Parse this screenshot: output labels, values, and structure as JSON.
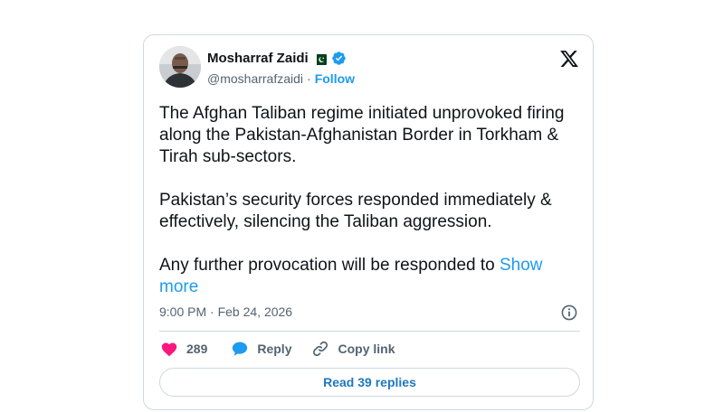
{
  "author": {
    "name": "Mosharraf Zaidi",
    "handle": "@mosharrafzaidi",
    "separator": "·",
    "follow_label": "Follow"
  },
  "tweet": {
    "paragraph1": "The Afghan Taliban regime initiated unprovoked firing along the Pakistan-Afghanistan Border in Torkham & Tirah sub-sectors.",
    "paragraph2": "Pakistan’s security forces responded immediately & effectively, silencing the Taliban aggression.",
    "paragraph3": "Any further provocation will be responded to ",
    "show_more": "Show more",
    "timestamp": "9:00 PM · Feb 24, 2026"
  },
  "actions": {
    "like_count": "289",
    "reply_label": "Reply",
    "copy_link_label": "Copy link"
  },
  "read_replies_label": "Read 39 replies",
  "colors": {
    "accent": "#1d9bf0",
    "like": "#f91880",
    "text_secondary": "#536471",
    "border": "#cfd9de"
  },
  "icons": [
    "avatar",
    "pakistan-flag-icon",
    "verified-badge-icon",
    "x-logo-icon",
    "info-icon",
    "heart-icon",
    "reply-bubble-icon",
    "link-icon"
  ]
}
